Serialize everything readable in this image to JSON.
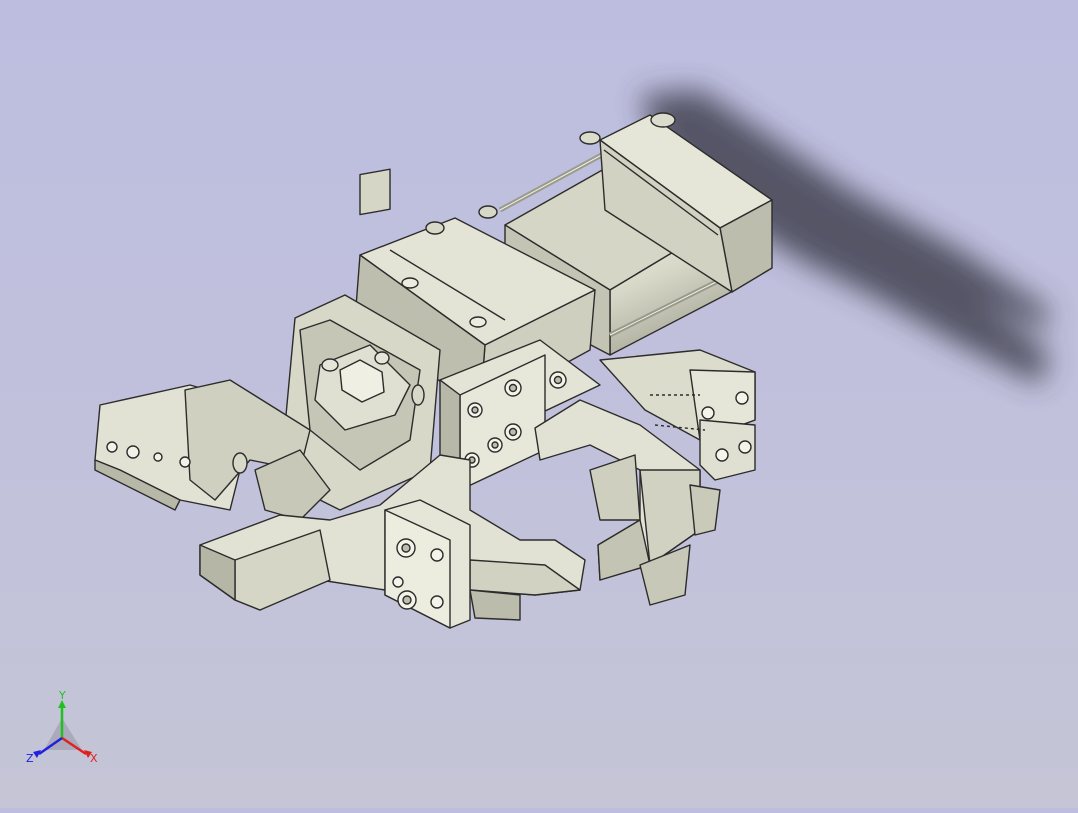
{
  "viewport": {
    "model": "gripper-assembly",
    "colors": {
      "background_top": "#bdbde0",
      "background_bottom": "#c5c5d6",
      "part_light": "#e4e4d6",
      "part_mid": "#cacabb",
      "part_dark": "#a9a99b",
      "edge": "#2c2c2c",
      "shadow": "#3a3a48"
    }
  },
  "triad": {
    "x_label": "X",
    "y_label": "Y",
    "z_label": "Z",
    "x_color": "#e02020",
    "y_color": "#20c020",
    "z_color": "#2020e0"
  }
}
